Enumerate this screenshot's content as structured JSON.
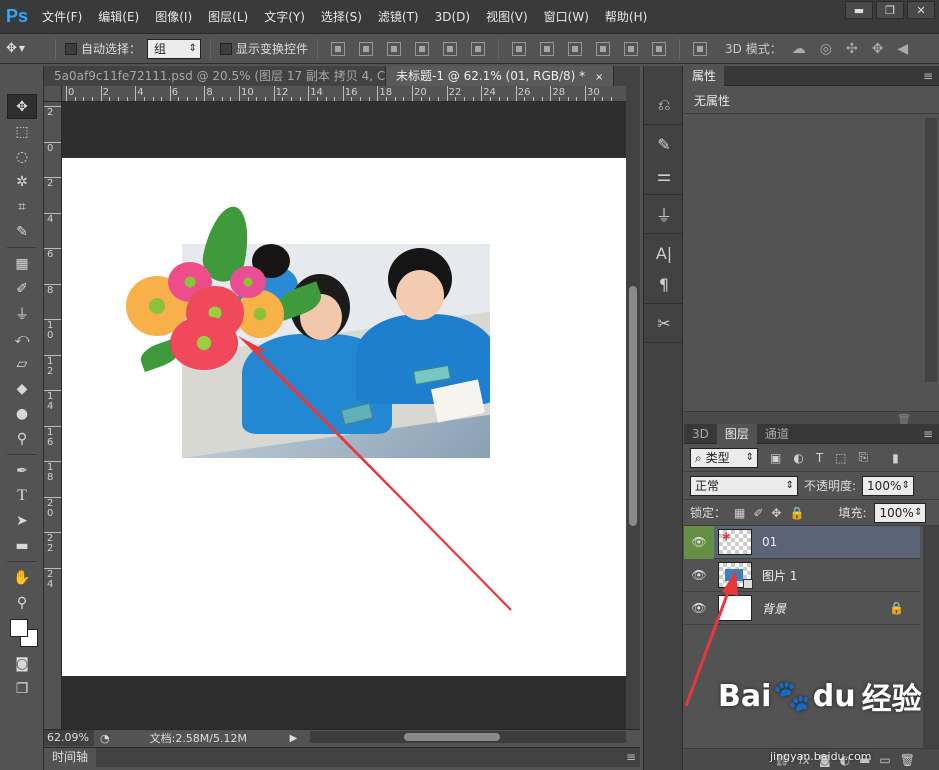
{
  "app": {
    "logo": "Ps",
    "menu": [
      "文件(F)",
      "编辑(E)",
      "图像(I)",
      "图层(L)",
      "文字(Y)",
      "选择(S)",
      "滤镜(T)",
      "3D(D)",
      "视图(V)",
      "窗口(W)",
      "帮助(H)"
    ],
    "window_controls": {
      "minimize": "▬",
      "restore": "❐",
      "close": "✕"
    }
  },
  "options_bar": {
    "move_tool_icon": "move-icon",
    "auto_select_label": "自动选择：",
    "auto_select_value": "组",
    "show_transform_label": "显示变换控件",
    "mode_label": "3D 模式："
  },
  "tabs": [
    {
      "label": "5a0af9c11fe72111.psd @ 20.5% (图层 17 副本 拷贝 4, C...",
      "close": ""
    },
    {
      "label": "未标题-1 @ 62.1% (01, RGB/8) *",
      "close": "×"
    }
  ],
  "rulers": {
    "top_ticks": [
      "0",
      "2",
      "4",
      "6",
      "8",
      "10",
      "12",
      "14",
      "16",
      "18",
      "20",
      "22",
      "24",
      "26",
      "28",
      "30"
    ],
    "left_ticks": [
      "2",
      "0",
      "2",
      "4",
      "6",
      "8",
      "1\n0",
      "1\n2",
      "1\n4",
      "1\n6",
      "1\n8",
      "2\n0",
      "2\n2",
      "2\n4"
    ]
  },
  "status": {
    "zoom": "62.09%",
    "doc_info": "文档:2.58M/5.12M"
  },
  "timeline": {
    "label": "时间轴"
  },
  "properties": {
    "tab": "属性",
    "content": "无属性"
  },
  "layers_panel": {
    "tabs": [
      "3D",
      "图层",
      "通道"
    ],
    "filter_label": "类型",
    "blend_mode": "正常",
    "opacity_label": "不透明度:",
    "opacity_value": "100%",
    "lock_label": "锁定：",
    "fill_label": "填充:",
    "fill_value": "100%",
    "layers": [
      {
        "name": "01",
        "selected": true,
        "italic": false,
        "locked": false
      },
      {
        "name": "图片 1",
        "selected": false,
        "italic": false,
        "locked": false
      },
      {
        "name": "背景",
        "selected": false,
        "italic": true,
        "locked": true
      }
    ]
  },
  "watermark": {
    "text_left": "Bai",
    "text_mid": "du",
    "text_right": "经验",
    "sub": "jingyan.baidu.com"
  },
  "colors": {
    "annotation_arrow": "#e8383d",
    "selected_layer": "#5b6476",
    "eye_active": "#668f46"
  }
}
